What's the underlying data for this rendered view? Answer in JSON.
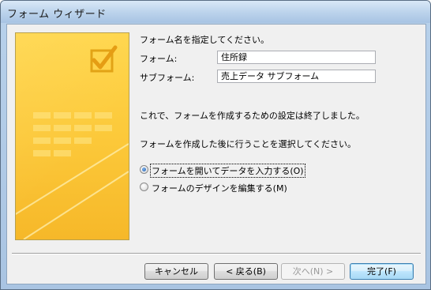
{
  "window": {
    "title": "フォーム ウィザード"
  },
  "instruction": "フォーム名を指定してください。",
  "fields": [
    {
      "label": "フォーム:",
      "value": "住所録"
    },
    {
      "label": "サブフォーム:",
      "value": "売上データ サブフォーム"
    }
  ],
  "completion_message": "これで、フォームを作成するための設定は終了しました。",
  "next_action_prompt": "フォームを作成した後に行うことを選択してください。",
  "options": [
    {
      "label": "フォームを開いてデータを入力する(O)",
      "checked": true
    },
    {
      "label": "フォームのデザインを編集する(M)",
      "checked": false
    }
  ],
  "buttons": {
    "cancel": "キャンセル",
    "back": "< 戻る(B)",
    "next": "次へ(N) >",
    "finish": "完了(F)"
  },
  "banner_icon": "checkbox-check-icon"
}
